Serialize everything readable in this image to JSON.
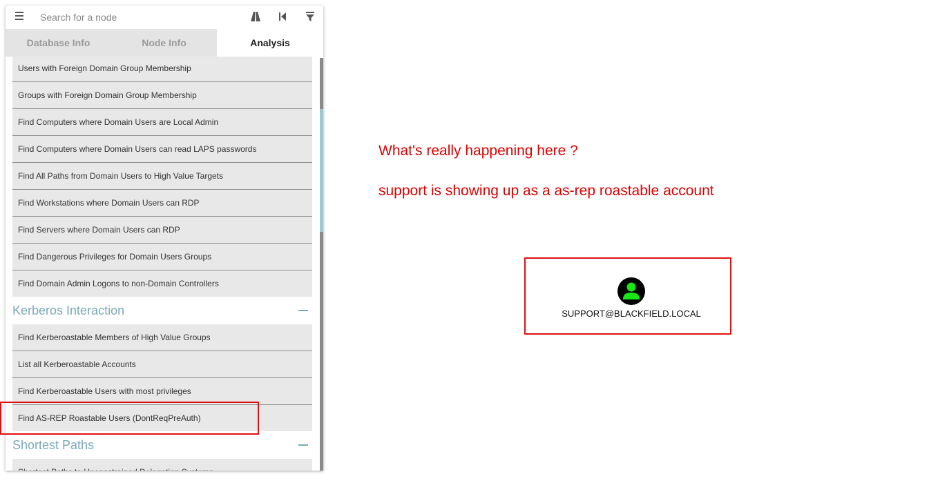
{
  "search": {
    "placeholder": "Search for a node",
    "menu_icon": "hamburger-menu-icon",
    "tool_icons": [
      "pathfinding-icon",
      "back-icon",
      "filter-icon"
    ]
  },
  "tabs": [
    {
      "label": "Database Info",
      "active": false
    },
    {
      "label": "Node Info",
      "active": false
    },
    {
      "label": "Analysis",
      "active": true
    }
  ],
  "analysis": {
    "general_items": [
      "Users with Foreign Domain Group Membership",
      "Groups with Foreign Domain Group Membership",
      "Find Computers where Domain Users are Local Admin",
      "Find Computers where Domain Users can read LAPS passwords",
      "Find All Paths from Domain Users to High Value Targets",
      "Find Workstations where Domain Users can RDP",
      "Find Servers where Domain Users can RDP",
      "Find Dangerous Privileges for Domain Users Groups",
      "Find Domain Admin Logons to non-Domain Controllers"
    ],
    "kerberos": {
      "title": "Kerberos Interaction",
      "items": [
        "Find Kerberoastable Members of High Value Groups",
        "List all Kerberoastable Accounts",
        "Find Kerberoastable Users with most privileges",
        "Find AS-REP Roastable Users (DontReqPreAuth)"
      ]
    },
    "shortest": {
      "title": "Shortest Paths",
      "items": [
        "Shortest Paths to Unconstrained Delegation Systems"
      ]
    }
  },
  "notes": [
    "What's really happening here ?",
    "support is showing up as a as-rep roastable account"
  ],
  "graph": {
    "node_label": "SUPPORT@BLACKFIELD.LOCAL",
    "node_icon": "user-icon",
    "node_color": "#17e617"
  },
  "colors": {
    "annotation_red": "#e00000",
    "section_title": "#7aa9b9",
    "item_bg": "#e8e8e8"
  }
}
